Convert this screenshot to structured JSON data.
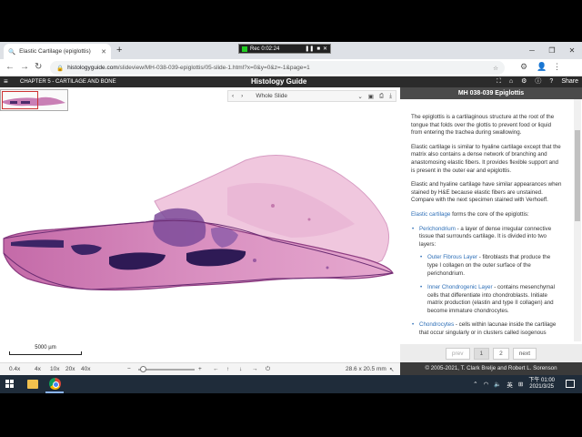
{
  "recorder": {
    "time": "Rec 0:02:24"
  },
  "browser": {
    "tab_title": "Elastic Cartilage (epiglottis)",
    "url_host": "histologyguide.com",
    "url_path": "/slideview/MH-038-039-epiglottis/05-slide-1.html?x=0&y=0&z=-1&page=1"
  },
  "app": {
    "chapter": "CHAPTER 5 - CARTILAGE AND BONE",
    "title": "Histology Guide",
    "share_label": "Share"
  },
  "viewer": {
    "view_label": "Whole Slide",
    "scale_label": "5000 µm",
    "zoom_levels": [
      "0.4x",
      "4x",
      "10x",
      "20x",
      "40x"
    ],
    "dimensions": "28.6 x 20.5 mm"
  },
  "panel": {
    "slide_title": "MH 038-039 Epiglottis",
    "p1": "The epiglottis is a cartilaginous structure at the root of the tongue that folds over the glottis to prevent food or liquid from entering the trachea during swallowing.",
    "p2": "Elastic cartilage is similar to hyaline cartilage except that the matrix also contains a dense network of branching and anastomosing elastic fibers. It provides flexible support and is present in the outer ear and epiglottis.",
    "p3": "Elastic and hyaline cartilage have similar appearances when stained by H&E because elastic fibers are unstained. Compare with the next specimen stained with Verhoeff.",
    "p4_link": "Elastic cartilage",
    "p4_rest": " forms the core of the epiglottis:",
    "perichondrium_link": "Perichondrium",
    "perichondrium_text": " - a layer of dense irregular connective tissue that surrounds cartilage. It is divided into two layers:",
    "outer_link": "Outer Fibrous Layer",
    "outer_text": " - fibroblasts that produce the type I collagen on the outer surface of the perichondrium.",
    "inner_link": "Inner Chondrogenic Layer",
    "inner_text": " - contains mesenchymal cells that differentiate into chondroblasts. Initiate matrix production (elastin and type II collagen) and become immature chondrocytes.",
    "chondro_link": "Chondrocytes",
    "chondro_text": " - cells within lacunae inside the cartilage that occur singularly or in clusters called isogenous",
    "pager": {
      "prev": "prev",
      "page1": "1",
      "page2": "2",
      "next": "next"
    },
    "copyright": "© 2005-2021, T. Clark Brelje and Robert L. Sorenson"
  },
  "taskbar": {
    "ime": "英",
    "time": "下午 01:00",
    "date": "2021/3/25"
  }
}
